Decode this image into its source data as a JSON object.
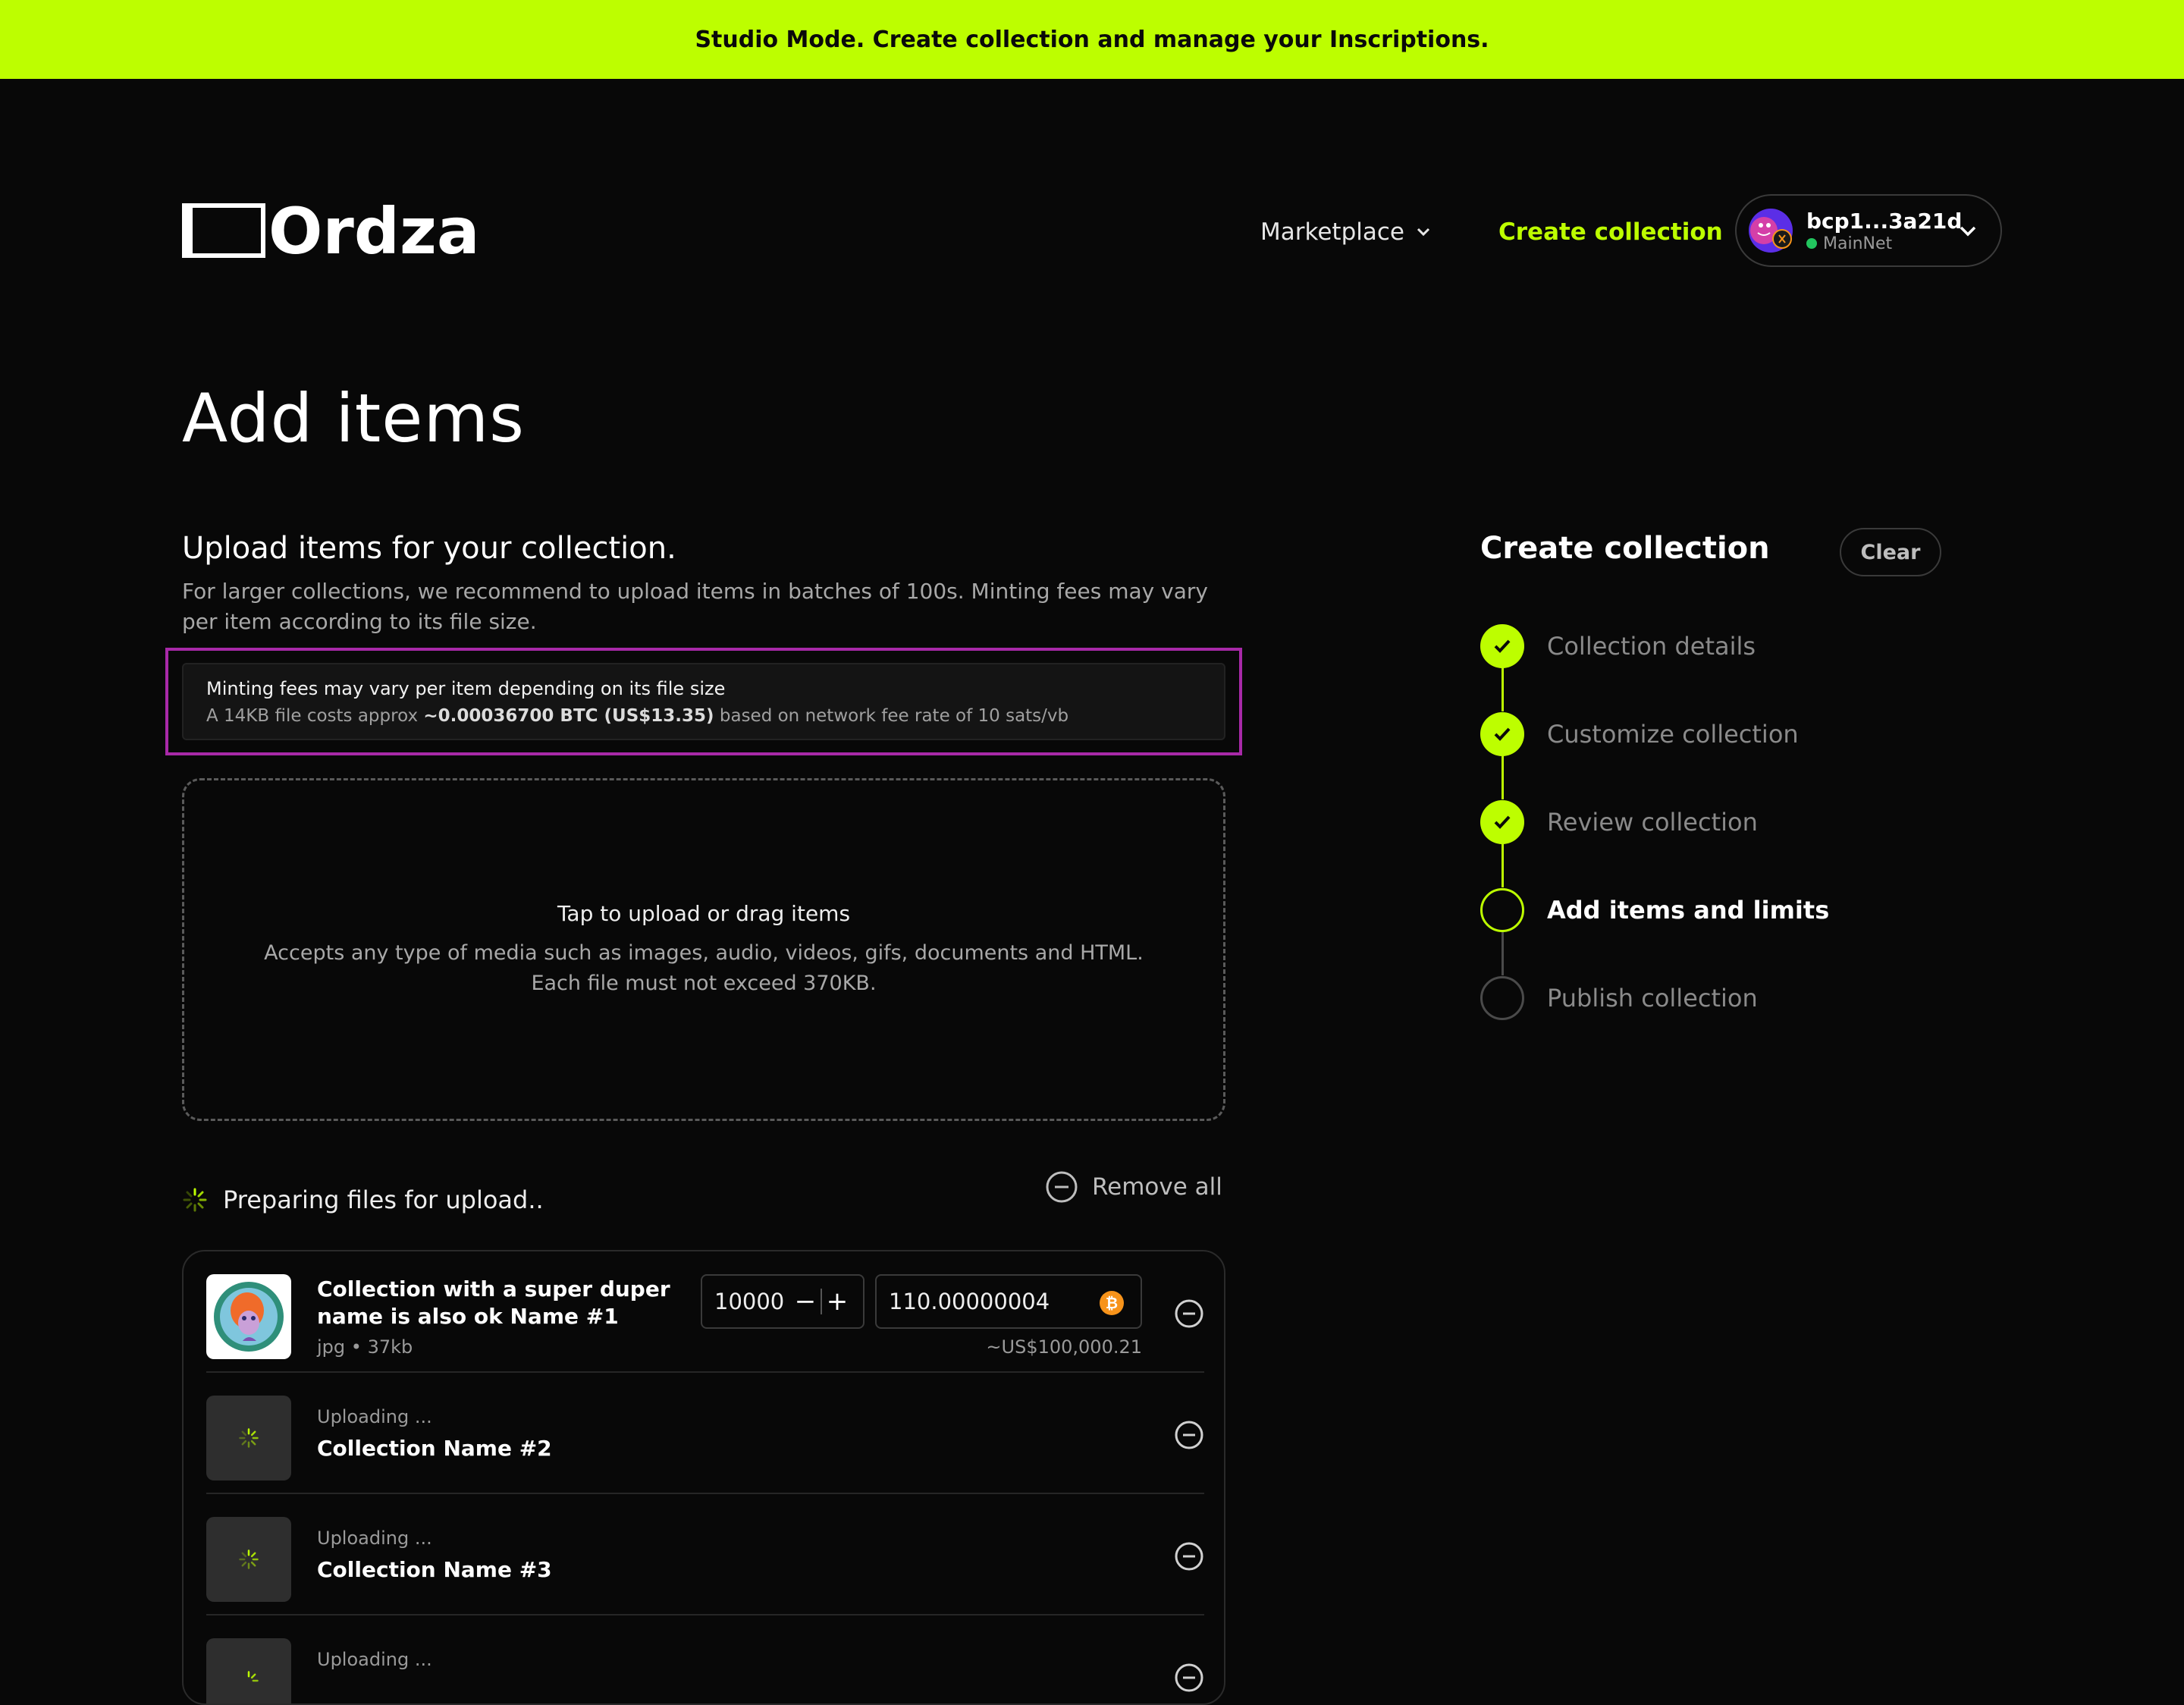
{
  "banner": {
    "text": "Studio Mode. Create collection and manage your Inscriptions."
  },
  "header": {
    "logo_text": "Ordzaar",
    "nav": {
      "marketplace": "Marketplace",
      "create_collection": "Create collection"
    },
    "wallet": {
      "address": "bcp1...3a21d",
      "network": "MainNet"
    }
  },
  "page": {
    "title": "Add items",
    "section_title": "Upload items for your collection.",
    "section_desc": "For larger collections, we recommend to upload items in batches of 100s. Minting fees may vary per item according to its file size."
  },
  "fee_notice": {
    "title": "Minting fees may vary per item depending on its file size",
    "prefix": "A 14KB file costs approx ",
    "amount": "~0.00036700 BTC (US$13.35)",
    "suffix": " based on network fee rate of 10 sats/vb"
  },
  "dropzone": {
    "title": "Tap to upload or drag items",
    "desc_line1": "Accepts any type of media such as images, audio, videos, gifs, documents and HTML.",
    "desc_line2": "Each file must not exceed 370KB."
  },
  "upload": {
    "status": "Preparing files for upload..",
    "remove_all": "Remove all",
    "items": [
      {
        "name_line1": "Collection with a super duper",
        "name_line2": "name is also ok Name #1",
        "type": "jpg",
        "size": "37kb",
        "quantity": "10000",
        "price": "110.00000004",
        "usd": "~US$100,000.21"
      },
      {
        "status": "Uploading ...",
        "name": "Collection Name #2"
      },
      {
        "status": "Uploading ...",
        "name": "Collection Name #3"
      },
      {
        "status": "Uploading ...",
        "name": ""
      }
    ]
  },
  "sidebar": {
    "title": "Create collection",
    "clear": "Clear",
    "steps": [
      {
        "label": "Collection details",
        "state": "done"
      },
      {
        "label": "Customize collection",
        "state": "done"
      },
      {
        "label": "Review collection",
        "state": "done"
      },
      {
        "label": "Add items and limits",
        "state": "current"
      },
      {
        "label": "Publish collection",
        "state": "todo"
      }
    ]
  },
  "colors": {
    "accent": "#bdfe00",
    "highlight": "#a829a8",
    "bitcoin": "#f7931a",
    "online": "#22c55e"
  }
}
